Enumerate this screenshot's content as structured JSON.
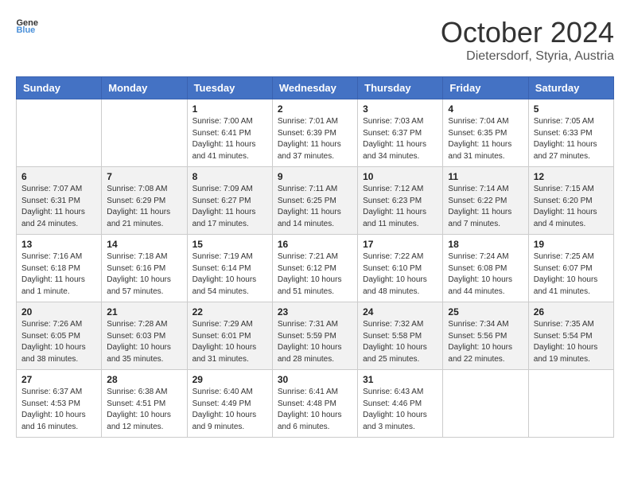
{
  "header": {
    "logo_general": "General",
    "logo_blue": "Blue",
    "month_title": "October 2024",
    "subtitle": "Dietersdorf, Styria, Austria"
  },
  "days_of_week": [
    "Sunday",
    "Monday",
    "Tuesday",
    "Wednesday",
    "Thursday",
    "Friday",
    "Saturday"
  ],
  "weeks": [
    [
      {
        "day": "",
        "info": ""
      },
      {
        "day": "",
        "info": ""
      },
      {
        "day": "1",
        "info": "Sunrise: 7:00 AM\nSunset: 6:41 PM\nDaylight: 11 hours and 41 minutes."
      },
      {
        "day": "2",
        "info": "Sunrise: 7:01 AM\nSunset: 6:39 PM\nDaylight: 11 hours and 37 minutes."
      },
      {
        "day": "3",
        "info": "Sunrise: 7:03 AM\nSunset: 6:37 PM\nDaylight: 11 hours and 34 minutes."
      },
      {
        "day": "4",
        "info": "Sunrise: 7:04 AM\nSunset: 6:35 PM\nDaylight: 11 hours and 31 minutes."
      },
      {
        "day": "5",
        "info": "Sunrise: 7:05 AM\nSunset: 6:33 PM\nDaylight: 11 hours and 27 minutes."
      }
    ],
    [
      {
        "day": "6",
        "info": "Sunrise: 7:07 AM\nSunset: 6:31 PM\nDaylight: 11 hours and 24 minutes."
      },
      {
        "day": "7",
        "info": "Sunrise: 7:08 AM\nSunset: 6:29 PM\nDaylight: 11 hours and 21 minutes."
      },
      {
        "day": "8",
        "info": "Sunrise: 7:09 AM\nSunset: 6:27 PM\nDaylight: 11 hours and 17 minutes."
      },
      {
        "day": "9",
        "info": "Sunrise: 7:11 AM\nSunset: 6:25 PM\nDaylight: 11 hours and 14 minutes."
      },
      {
        "day": "10",
        "info": "Sunrise: 7:12 AM\nSunset: 6:23 PM\nDaylight: 11 hours and 11 minutes."
      },
      {
        "day": "11",
        "info": "Sunrise: 7:14 AM\nSunset: 6:22 PM\nDaylight: 11 hours and 7 minutes."
      },
      {
        "day": "12",
        "info": "Sunrise: 7:15 AM\nSunset: 6:20 PM\nDaylight: 11 hours and 4 minutes."
      }
    ],
    [
      {
        "day": "13",
        "info": "Sunrise: 7:16 AM\nSunset: 6:18 PM\nDaylight: 11 hours and 1 minute."
      },
      {
        "day": "14",
        "info": "Sunrise: 7:18 AM\nSunset: 6:16 PM\nDaylight: 10 hours and 57 minutes."
      },
      {
        "day": "15",
        "info": "Sunrise: 7:19 AM\nSunset: 6:14 PM\nDaylight: 10 hours and 54 minutes."
      },
      {
        "day": "16",
        "info": "Sunrise: 7:21 AM\nSunset: 6:12 PM\nDaylight: 10 hours and 51 minutes."
      },
      {
        "day": "17",
        "info": "Sunrise: 7:22 AM\nSunset: 6:10 PM\nDaylight: 10 hours and 48 minutes."
      },
      {
        "day": "18",
        "info": "Sunrise: 7:24 AM\nSunset: 6:08 PM\nDaylight: 10 hours and 44 minutes."
      },
      {
        "day": "19",
        "info": "Sunrise: 7:25 AM\nSunset: 6:07 PM\nDaylight: 10 hours and 41 minutes."
      }
    ],
    [
      {
        "day": "20",
        "info": "Sunrise: 7:26 AM\nSunset: 6:05 PM\nDaylight: 10 hours and 38 minutes."
      },
      {
        "day": "21",
        "info": "Sunrise: 7:28 AM\nSunset: 6:03 PM\nDaylight: 10 hours and 35 minutes."
      },
      {
        "day": "22",
        "info": "Sunrise: 7:29 AM\nSunset: 6:01 PM\nDaylight: 10 hours and 31 minutes."
      },
      {
        "day": "23",
        "info": "Sunrise: 7:31 AM\nSunset: 5:59 PM\nDaylight: 10 hours and 28 minutes."
      },
      {
        "day": "24",
        "info": "Sunrise: 7:32 AM\nSunset: 5:58 PM\nDaylight: 10 hours and 25 minutes."
      },
      {
        "day": "25",
        "info": "Sunrise: 7:34 AM\nSunset: 5:56 PM\nDaylight: 10 hours and 22 minutes."
      },
      {
        "day": "26",
        "info": "Sunrise: 7:35 AM\nSunset: 5:54 PM\nDaylight: 10 hours and 19 minutes."
      }
    ],
    [
      {
        "day": "27",
        "info": "Sunrise: 6:37 AM\nSunset: 4:53 PM\nDaylight: 10 hours and 16 minutes."
      },
      {
        "day": "28",
        "info": "Sunrise: 6:38 AM\nSunset: 4:51 PM\nDaylight: 10 hours and 12 minutes."
      },
      {
        "day": "29",
        "info": "Sunrise: 6:40 AM\nSunset: 4:49 PM\nDaylight: 10 hours and 9 minutes."
      },
      {
        "day": "30",
        "info": "Sunrise: 6:41 AM\nSunset: 4:48 PM\nDaylight: 10 hours and 6 minutes."
      },
      {
        "day": "31",
        "info": "Sunrise: 6:43 AM\nSunset: 4:46 PM\nDaylight: 10 hours and 3 minutes."
      },
      {
        "day": "",
        "info": ""
      },
      {
        "day": "",
        "info": ""
      }
    ]
  ]
}
